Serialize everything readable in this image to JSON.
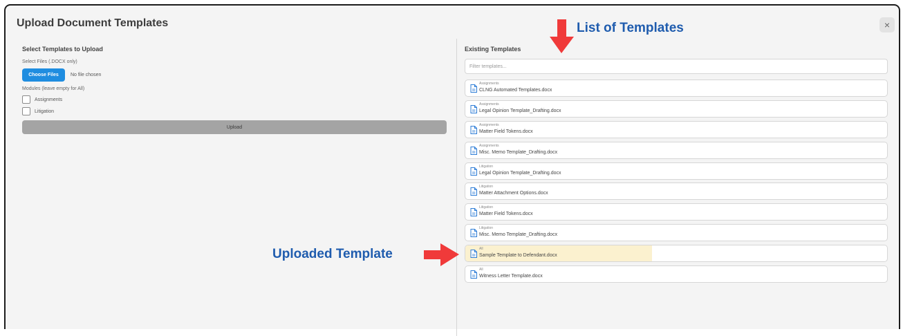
{
  "dialog": {
    "title": "Upload Document Templates",
    "close_glyph": "×"
  },
  "upload_panel": {
    "heading": "Select Templates to Upload",
    "file_label": "Select Files (.DOCX only)",
    "choose_button": "Choose Files",
    "file_status": "No file chosen",
    "modules_label": "Modules (leave empty for All)",
    "modules": [
      {
        "label": "Assignments",
        "checked": false
      },
      {
        "label": "Litigation",
        "checked": false
      }
    ],
    "upload_button": "Upload"
  },
  "templates_panel": {
    "heading": "Existing Templates",
    "filter_placeholder": "Filter templates...",
    "items": [
      {
        "module": "Assignments",
        "name": "CLNG Automated Templates.docx",
        "highlighted": false
      },
      {
        "module": "Assignments",
        "name": "Legal Opinion Template_Drafting.docx",
        "highlighted": false
      },
      {
        "module": "Assignments",
        "name": "Matter Field Tokens.docx",
        "highlighted": false
      },
      {
        "module": "Assignments",
        "name": "Misc. Memo Template_Drafting.docx",
        "highlighted": false
      },
      {
        "module": "Litigation",
        "name": "Legal Opinion Template_Drafting.docx",
        "highlighted": false
      },
      {
        "module": "Litigation",
        "name": "Matter Attachment Options.docx",
        "highlighted": false
      },
      {
        "module": "Litigation",
        "name": "Matter Field Tokens.docx",
        "highlighted": false
      },
      {
        "module": "Litigation",
        "name": "Misc. Memo Template_Drafting.docx",
        "highlighted": false
      },
      {
        "module": "All",
        "name": "Sample Template to Defendant.docx",
        "highlighted": true
      },
      {
        "module": "All",
        "name": "Witness Letter Template.docx",
        "highlighted": false
      }
    ]
  },
  "annotations": {
    "list_label": "List of Templates",
    "uploaded_label": "Uploaded Template",
    "arrow_color": "#f03a3a",
    "text_color": "#1f5cae"
  },
  "colors": {
    "accent": "#1f8de0",
    "highlight": "#fbf1cf",
    "icon": "#2b7bd6"
  }
}
